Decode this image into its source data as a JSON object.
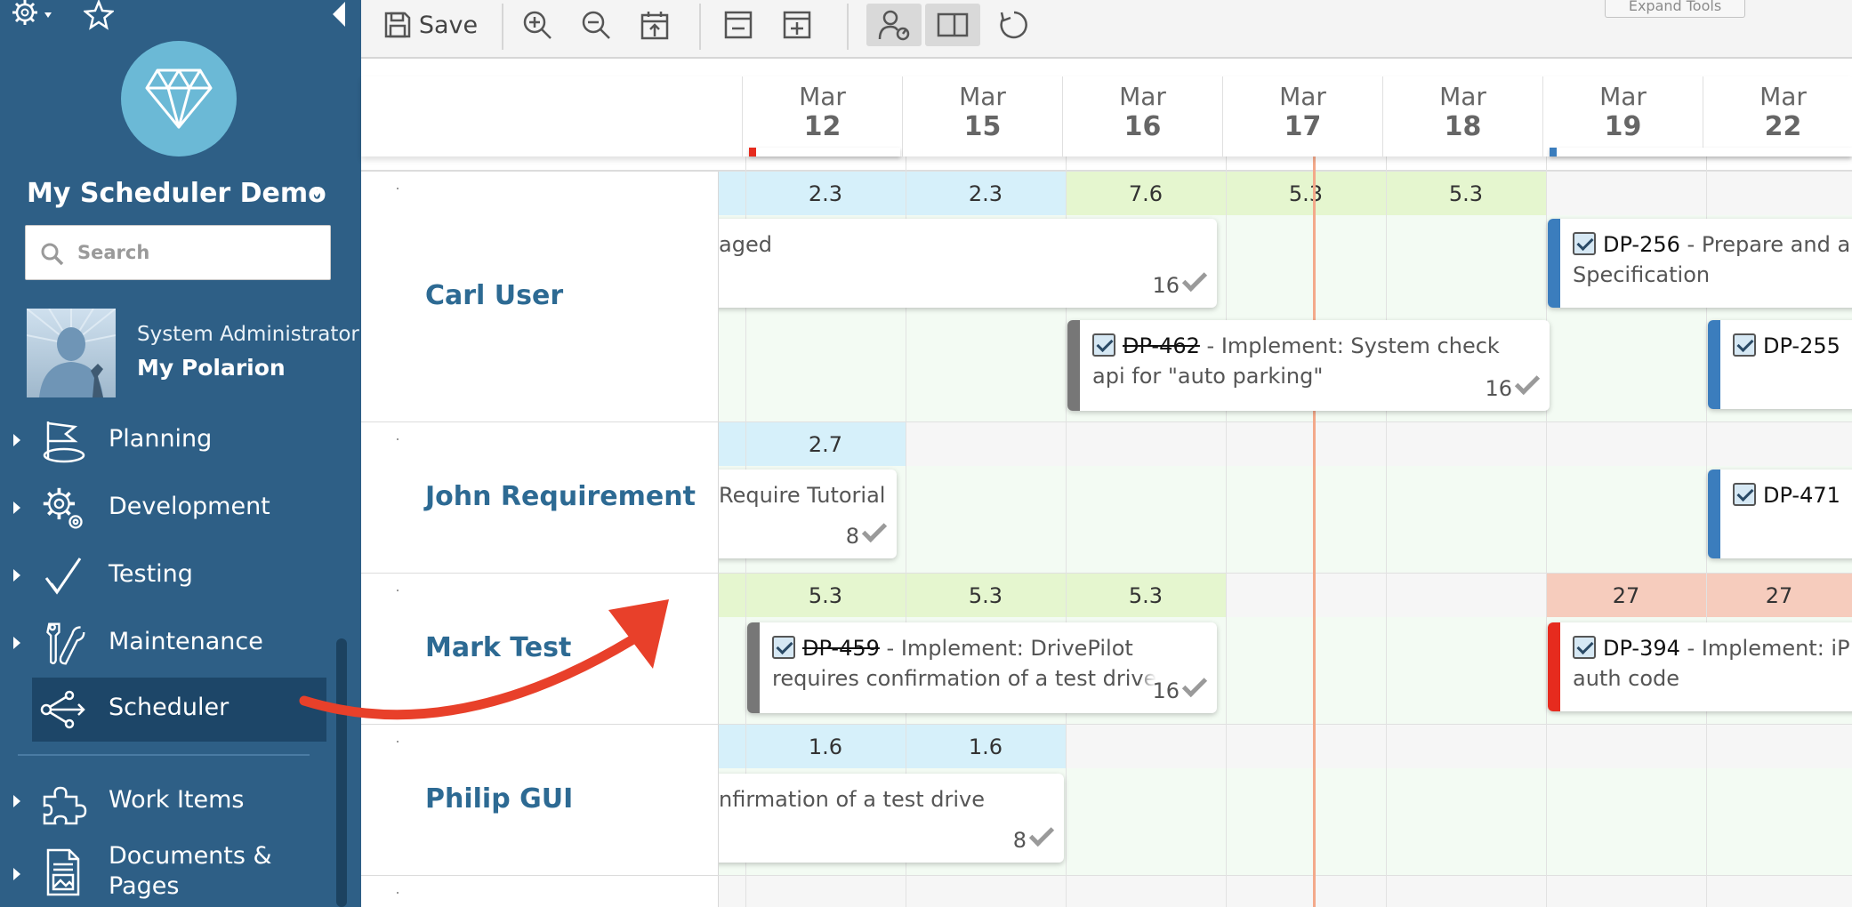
{
  "sidebar": {
    "project_name": "My Scheduler Demo",
    "search_placeholder": "Search",
    "user_role": "System Administrator",
    "user_link": "My Polarion",
    "nav": [
      {
        "label": "Planning",
        "icon": "flag-icon"
      },
      {
        "label": "Development",
        "icon": "gears-icon"
      },
      {
        "label": "Testing",
        "icon": "check-icon"
      },
      {
        "label": "Maintenance",
        "icon": "tools-icon"
      },
      {
        "label": "Scheduler",
        "icon": "share-icon"
      },
      {
        "label": "Work Items",
        "icon": "puzzle-icon"
      },
      {
        "label": "Documents & Pages",
        "icon": "document-icon"
      }
    ],
    "active_item": "Scheduler"
  },
  "toolbar": {
    "save_label": "Save",
    "expand_tools_label": "Expand Tools"
  },
  "dates": [
    {
      "mon": "Mar",
      "day": "12"
    },
    {
      "mon": "Mar",
      "day": "15"
    },
    {
      "mon": "Mar",
      "day": "16"
    },
    {
      "mon": "Mar",
      "day": "17"
    },
    {
      "mon": "Mar",
      "day": "18"
    },
    {
      "mon": "Mar",
      "day": "19"
    },
    {
      "mon": "Mar",
      "day": "22"
    }
  ],
  "people": [
    {
      "name": "Carl User",
      "capacity": [
        "2.3",
        "2.3",
        "7.6",
        "5.3",
        "5.3"
      ],
      "cards": [
        {
          "id": "",
          "title": "aged",
          "hours": "16"
        },
        {
          "id": "DP-462",
          "title": "Implement: System check api for \"auto parking\"",
          "hours": "16",
          "struck": true
        },
        {
          "id": "DP-256",
          "title": "Prepare and a Specification",
          "hours": ""
        },
        {
          "id": "DP-255",
          "title": "",
          "hours": ""
        }
      ]
    },
    {
      "name": "John Requirement",
      "capacity": [
        "2.7"
      ],
      "cards": [
        {
          "id": "",
          "title": "Require Tutorial",
          "hours": "8"
        },
        {
          "id": "DP-471",
          "title": "",
          "hours": ""
        }
      ]
    },
    {
      "name": "Mark Test",
      "capacity": [
        "5.3",
        "5.3",
        "5.3",
        "27",
        "27"
      ],
      "cards": [
        {
          "id": "DP-459",
          "title": "Implement: DrivePilot requires confirmation of a test drive",
          "hours": "16",
          "struck": true
        },
        {
          "id": "DP-394",
          "title": "Implement: iP auth code",
          "hours": ""
        }
      ]
    },
    {
      "name": "Philip GUI",
      "capacity": [
        "1.6",
        "1.6"
      ],
      "cards": [
        {
          "id": "",
          "title": "nfirmation of a test drive",
          "hours": "8"
        }
      ]
    }
  ],
  "colors": {
    "sidebar_bg": "#2e5f86",
    "sidebar_active": "#1d4668",
    "name_text": "#2d6a93",
    "today_line": "#f3a98a",
    "card_bar_gray": "#777777",
    "card_bar_blue": "#3b7dbd",
    "card_bar_red": "#e62b1e",
    "annotation_arrow": "#e8402a"
  }
}
